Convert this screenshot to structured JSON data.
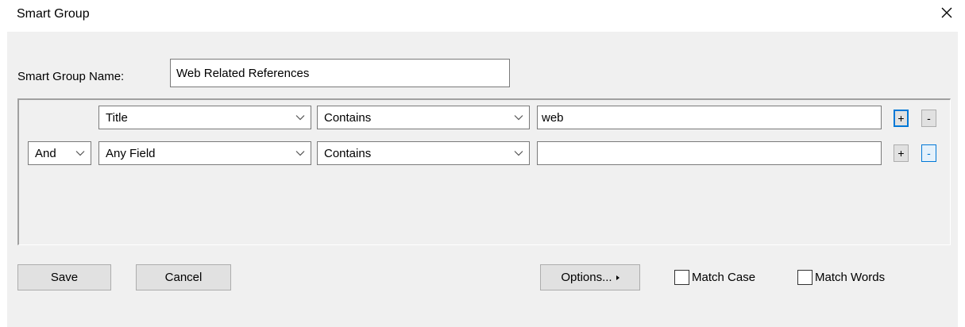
{
  "window": {
    "title": "Smart Group",
    "close_icon": "close-icon"
  },
  "form": {
    "name_label": "Smart Group Name:",
    "name_value": "Web Related References"
  },
  "criteria": {
    "rows": [
      {
        "connector": "",
        "field": "Title",
        "operator": "Contains",
        "value": "web",
        "add_label": "+",
        "remove_label": "-"
      },
      {
        "connector": "And",
        "field": "Any Field",
        "operator": "Contains",
        "value": "",
        "add_label": "+",
        "remove_label": "-"
      }
    ]
  },
  "buttons": {
    "save": "Save",
    "cancel": "Cancel",
    "options": "Options..."
  },
  "checkboxes": {
    "match_case": {
      "label": "Match Case",
      "checked": false
    },
    "match_words": {
      "label": "Match Words",
      "checked": false
    }
  },
  "colors": {
    "dialog_bg": "#f0f0f0",
    "focus_accent": "#0078d7",
    "button_face": "#e1e1e1"
  }
}
